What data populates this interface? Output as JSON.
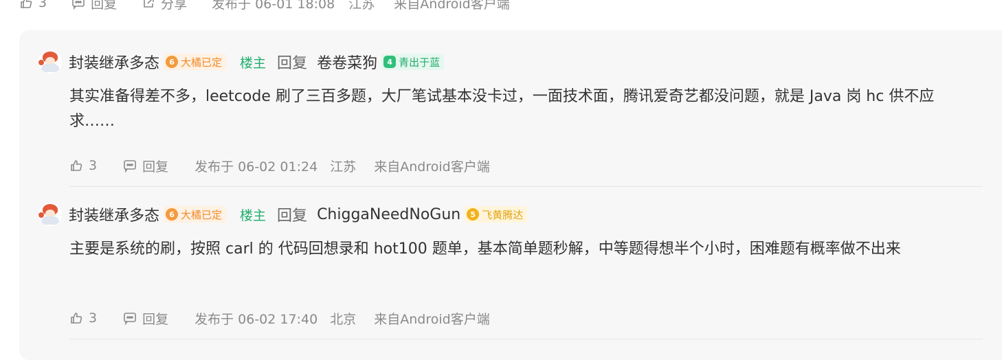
{
  "top_bar": {
    "like_count": "3",
    "reply_label": "回复",
    "share_label": "分享",
    "published": "发布于 06-01 18:08",
    "location": "江苏",
    "source": "来自Android客户端"
  },
  "replies": [
    {
      "author": "封装继承多态",
      "author_badge": {
        "level": "6",
        "title": "大橘已定"
      },
      "op_tag": "楼主",
      "reply_word": "回复",
      "target": "卷卷菜狗",
      "target_badge": {
        "level": "4",
        "title": "青出于蓝"
      },
      "text": "其实准备得差不多，leetcode 刷了三百多题，大厂笔试基本没卡过，一面技术面，腾讯爱奇艺都没问题，就是 Java 岗 hc 供不应求……",
      "like_count": "3",
      "reply_label": "回复",
      "published": "发布于 06-02 01:24",
      "location": "江苏",
      "source": "来自Android客户端"
    },
    {
      "author": "封装继承多态",
      "author_badge": {
        "level": "6",
        "title": "大橘已定"
      },
      "op_tag": "楼主",
      "reply_word": "回复",
      "target": "ChiggaNeedNoGun",
      "target_badge": {
        "level": "5",
        "title": "飞黄腾达"
      },
      "text": "主要是系统的刷，按照 carl 的 代码回想录和 hot100 题单，基本简单题秒解，中等题得想半个小时，困难题有概率做不出来",
      "like_count": "3",
      "reply_label": "回复",
      "published": "发布于 06-02 17:40",
      "location": "北京",
      "source": "来自Android客户端"
    }
  ],
  "colors": {
    "badge_orange": "#f39a3d",
    "badge_green": "#2fbf7a",
    "badge_yellow": "#f2b21c",
    "op_green": "#1fae6c",
    "meta_gray": "#8a8a8a",
    "reply_bg": "#f7f7f7"
  },
  "icons": {
    "like": "thumbs-up-icon",
    "reply": "comment-icon",
    "share": "share-icon",
    "avatar": "anime-avatar"
  }
}
